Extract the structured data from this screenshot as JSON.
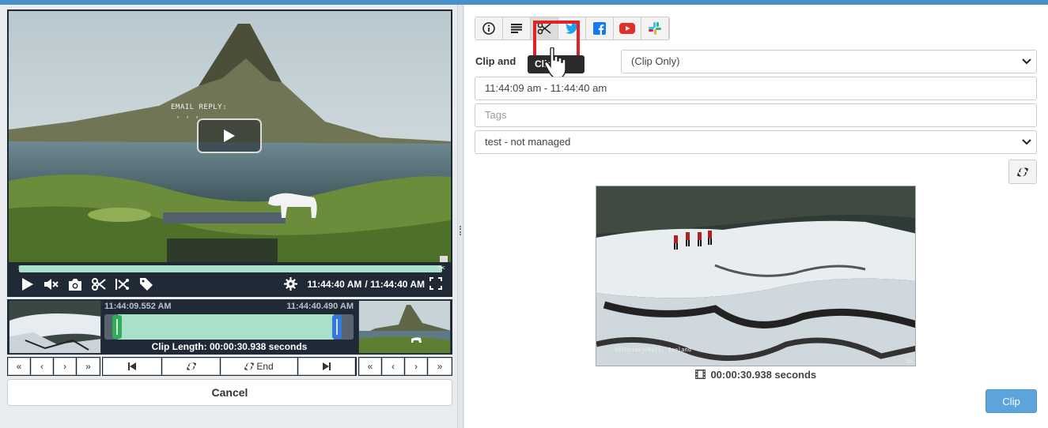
{
  "player": {
    "overlay_text": "EMAIL REPLY:",
    "overlay_quotes": "' ' '",
    "current_time": "11:44:40 AM",
    "total_time": "/ 11:44:40 AM",
    "controls": [
      "play-icon",
      "mute-icon",
      "camera-icon",
      "scissors-icon",
      "split-icon",
      "tag-icon",
      "gear-icon",
      "fullscreen-icon"
    ]
  },
  "trimmer": {
    "start_time": "11:44:09.552 AM",
    "end_time": "11:44:40.490 AM",
    "clip_length": "Clip Length: 00:00:30.938 seconds",
    "selection_start_fraction": 0.05,
    "selection_end_fraction": 0.92
  },
  "nav": {
    "left": [
      "«",
      "‹",
      "›",
      "»"
    ],
    "center_end_label": "End",
    "right": [
      "«",
      "‹",
      "›",
      "»"
    ]
  },
  "cancel_label": "Cancel",
  "tabs": [
    {
      "name": "info-icon"
    },
    {
      "name": "text-icon"
    },
    {
      "name": "scissors-icon",
      "active": true
    },
    {
      "name": "twitter-icon",
      "color": "#1da1f2"
    },
    {
      "name": "facebook-icon",
      "color": "#1877f2"
    },
    {
      "name": "youtube-icon",
      "color": "#e52d27"
    },
    {
      "name": "slack-icon"
    }
  ],
  "tooltip": "Clip",
  "form": {
    "label": "Clip and",
    "clip_mode": "(Clip Only)",
    "time_range": "11:44:09 am - 11:44:40 am",
    "tags_placeholder": "Tags",
    "management": "test - not managed"
  },
  "preview": {
    "caption": "Sólheimajökull, Iceland",
    "duration": "00:00:30.938 seconds"
  },
  "clip_button": "Clip",
  "colors": {
    "top_bar": "#4a90c8",
    "progress": "#a9e0c9",
    "highlight": "#e02424",
    "clip_button": "#5ba4dc"
  }
}
